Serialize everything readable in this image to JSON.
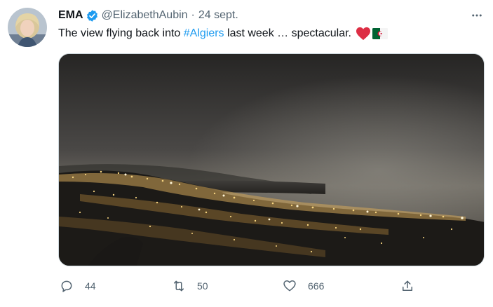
{
  "tweet": {
    "author": {
      "display_name": "EMA",
      "handle": "@ElizabethAubin",
      "separator": "·",
      "date": "24 sept."
    },
    "text": {
      "prefix": "The view flying back into ",
      "hashtag": "#Algiers",
      "suffix": " last week … spectacular.",
      "emojis": [
        "red-heart",
        "algeria-flag"
      ]
    },
    "media": {
      "description_icon": "aerial-night-city-photo"
    },
    "actions": {
      "reply_count": "44",
      "retweet_count": "50",
      "like_count": "666"
    },
    "colors": {
      "accent": "#1d9bf0",
      "secondary_text": "#536471",
      "primary_text": "#0f1419"
    }
  }
}
